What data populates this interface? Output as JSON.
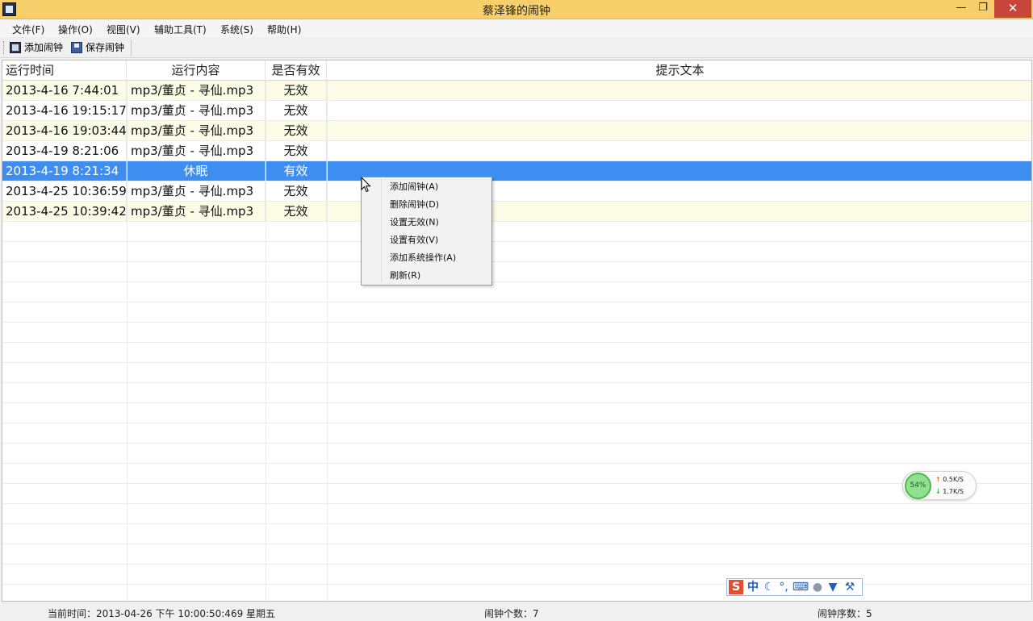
{
  "window": {
    "title": "蔡泽锋的闹钟",
    "minimize_label": "—",
    "restore_label": "❐",
    "close_label": "✕"
  },
  "menubar": {
    "items": [
      {
        "label": "文件(F)"
      },
      {
        "label": "操作(O)"
      },
      {
        "label": "视图(V)"
      },
      {
        "label": "辅助工具(T)"
      },
      {
        "label": "系统(S)"
      },
      {
        "label": "帮助(H)"
      }
    ]
  },
  "toolbar": {
    "add_label": "添加闹钟",
    "add_icon": "add-alarm-icon",
    "save_label": "保存闹钟",
    "save_icon": "save-icon"
  },
  "table": {
    "columns": [
      "运行时间",
      "运行内容",
      "是否有效",
      "提示文本"
    ],
    "rows": [
      {
        "time": "2013-4-16 7:44:01",
        "content": "mp3/董贞 - 寻仙.mp3",
        "valid": "无效",
        "hint": ""
      },
      {
        "time": "2013-4-16 19:15:17",
        "content": "mp3/董贞 - 寻仙.mp3",
        "valid": "无效",
        "hint": ""
      },
      {
        "time": "2013-4-16 19:03:44",
        "content": "mp3/董贞 - 寻仙.mp3",
        "valid": "无效",
        "hint": ""
      },
      {
        "time": "2013-4-19 8:21:06",
        "content": "mp3/董贞 - 寻仙.mp3",
        "valid": "无效",
        "hint": ""
      },
      {
        "time": "2013-4-19 8:21:34",
        "content": "休眠",
        "valid": "有效",
        "hint": ""
      },
      {
        "time": "2013-4-25 10:36:59",
        "content": "mp3/董贞 - 寻仙.mp3",
        "valid": "无效",
        "hint": ""
      },
      {
        "time": "2013-4-25 10:39:42",
        "content": "mp3/董贞 - 寻仙.mp3",
        "valid": "无效",
        "hint": ""
      }
    ],
    "selected_row": 4,
    "selection_color": "#3d8ef0",
    "alt_row_color": "#fcfbe6"
  },
  "context_menu": {
    "items": [
      {
        "label": "添加闹钟(A)"
      },
      {
        "label": "删除闹钟(D)"
      },
      {
        "label": "设置无效(N)"
      },
      {
        "label": "设置有效(V)"
      },
      {
        "label": "添加系统操作(A)"
      },
      {
        "label": "刷新(R)"
      }
    ]
  },
  "net_widget": {
    "percent": "54%",
    "up_speed": "0.5K/S",
    "down_speed": "1.7K/S"
  },
  "ime_bar": {
    "logo": "S",
    "mode": "中",
    "moon_icon": "moon-icon",
    "punct": "°,",
    "keyboard_icon": "keyboard-icon",
    "user_icon": "user-icon",
    "skin_icon": "shirt-icon",
    "tool_icon": "wrench-icon"
  },
  "statusbar": {
    "current_time": "当前时间：2013-04-26 下午 10:00:50:469   星期五",
    "alarm_count": "闹钟个数：7",
    "alarm_index": "闹钟序数：5"
  }
}
